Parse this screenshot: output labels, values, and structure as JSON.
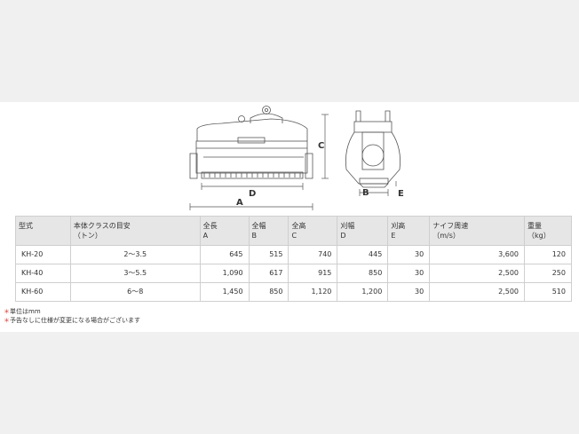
{
  "drawing": {
    "front_labels": {
      "A": "A",
      "C": "C",
      "D": "D"
    },
    "side_labels": {
      "B": "B",
      "E": "E"
    }
  },
  "table": {
    "headers": [
      {
        "line1": "型式",
        "line2": ""
      },
      {
        "line1": "本体クラスの目安",
        "line2": "（トン）"
      },
      {
        "line1": "全長",
        "line2": "A"
      },
      {
        "line1": "全幅",
        "line2": "B"
      },
      {
        "line1": "全高",
        "line2": "C"
      },
      {
        "line1": "刈幅",
        "line2": "D"
      },
      {
        "line1": "刈高",
        "line2": "E"
      },
      {
        "line1": "ナイフ周速",
        "line2": "（m/s）"
      },
      {
        "line1": "重量",
        "line2": "（kg）"
      }
    ],
    "rows": [
      {
        "model": "KH-20",
        "class": "2〜3.5",
        "A": "645",
        "B": "515",
        "C": "740",
        "D": "445",
        "E": "30",
        "speed": "3,600",
        "weight": "120"
      },
      {
        "model": "KH-40",
        "class": "3〜5.5",
        "A": "1,090",
        "B": "617",
        "C": "915",
        "D": "850",
        "E": "30",
        "speed": "2,500",
        "weight": "250"
      },
      {
        "model": "KH-60",
        "class": "6〜8",
        "A": "1,450",
        "B": "850",
        "C": "1,120",
        "D": "1,200",
        "E": "30",
        "speed": "2,500",
        "weight": "510"
      }
    ]
  },
  "notes": {
    "mark": "＊",
    "lines": [
      "単位はmm",
      "予告なしに仕様が変更になる場合がございます"
    ]
  },
  "colors": {
    "page_background": "#f0f0f0",
    "panel_background": "#ffffff",
    "header_fill": "#e6e6e6",
    "note_mark": "#d9342b"
  }
}
